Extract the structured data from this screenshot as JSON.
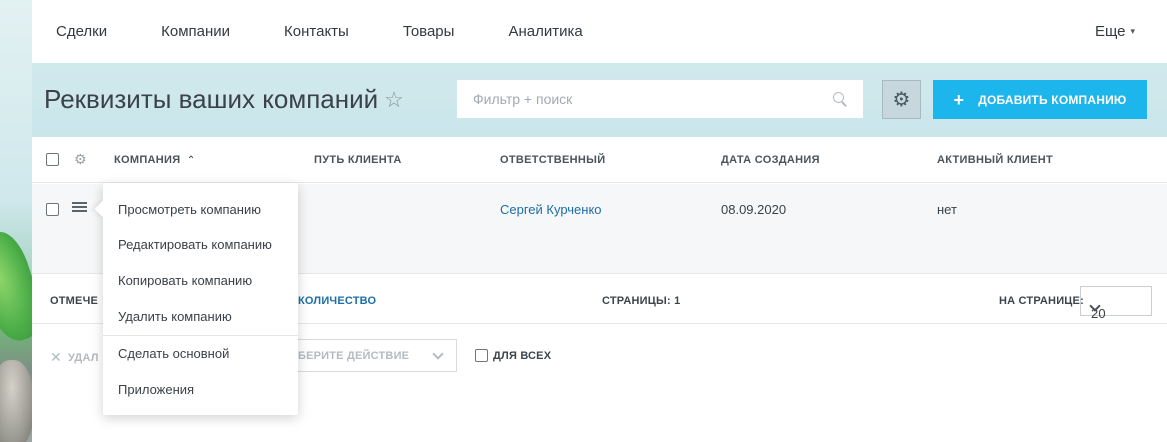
{
  "topnav": {
    "items": [
      "Сделки",
      "Компании",
      "Контакты",
      "Товары",
      "Аналитика"
    ],
    "more_label": "Еще"
  },
  "header": {
    "title": "Реквизиты ваших компаний",
    "search_placeholder": "Фильтр + поиск",
    "add_button_label": "ДОБАВИТЬ КОМПАНИЮ"
  },
  "table": {
    "columns": {
      "company": "КОМПАНИЯ",
      "path": "ПУТЬ КЛИЕНТА",
      "responsible": "ОТВЕТСТВЕННЫЙ",
      "created": "ДАТА СОЗДАНИЯ",
      "active": "АКТИВНЫЙ КЛИЕНТ"
    },
    "rows": [
      {
        "responsible": "Сергей Курченко",
        "created": "08.09.2020",
        "active": "нет"
      }
    ]
  },
  "footer": {
    "selected_label": "ОТМЕЧЕ",
    "count_label": "КОЛИЧЕСТВО",
    "pages_label": "СТРАНИЦЫ: 1",
    "per_page_label": "НА СТРАНИЦЕ:",
    "per_page_value": "20"
  },
  "actions": {
    "delete_label": "УДАЛ",
    "action_select_label": "ЫБЕРИТЕ ДЕЙСТВИЕ",
    "for_all_label": "ДЛЯ ВСЕХ"
  },
  "context_menu": {
    "items": [
      "Просмотреть компанию",
      "Редактировать компанию",
      "Копировать компанию",
      "Удалить компанию",
      "Сделать основной",
      "Приложения"
    ]
  },
  "colors": {
    "accent": "#1cb5ec",
    "link": "#1d6ea8"
  }
}
